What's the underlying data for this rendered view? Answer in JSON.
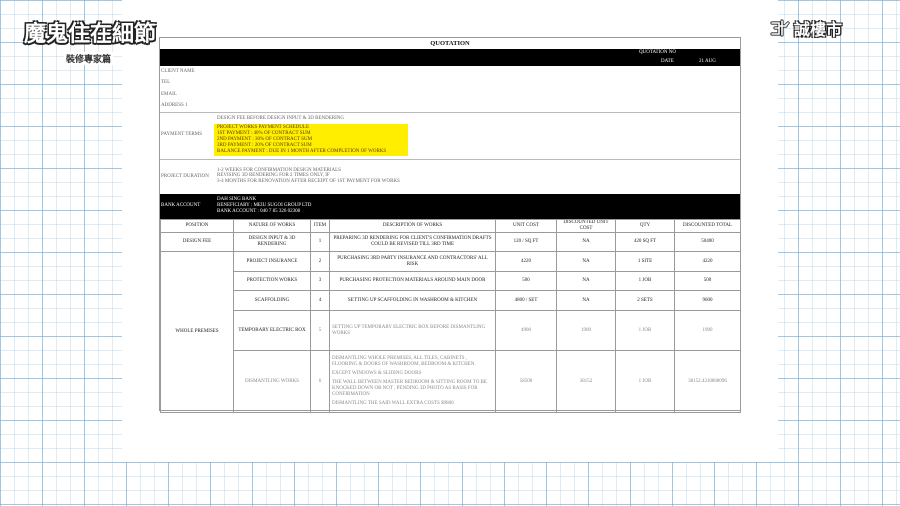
{
  "logos": {
    "left_title": "魔鬼住在細節",
    "left_subtitle": "裝修專家篇",
    "right_title": "誠樓市"
  },
  "doc": {
    "title": "QUOTATION",
    "quotation_no_label": "QUOTATION NO",
    "date_label": "DATE",
    "date_value": "21 AUG",
    "client_fields": [
      "CLIENT NAME",
      "TEL",
      "EMAIL",
      "ADDRESS 1"
    ],
    "design_fee_note": "DESIGN FEE BEFORE DESIGN INPUT & 3D RENDERING",
    "payment_terms_label": "PAYMENT TERMS",
    "payment_schedule": [
      "PROJECT WORKS PAYMENT SCHEDULE",
      "1ST PAYMENT : 40% OF CONTRACT SUM",
      "2ND PAYMENT : 30% OF CONTRACT SUM",
      "3RD PAYMENT : 20% OF CONTRACT SUM",
      "BALANCE PAYMENT : DUE IN 1 MONTH AFTER COMPLETION OF WORKS"
    ],
    "project_duration_label": "PROJECT DURATION",
    "duration_lines": [
      "1-2 WEEKS FOR CONFIRMATION DESIGN MATERIALS",
      "REVISING 3D RENDERING FOR 2 TIMES ONLY, IF",
      "3-4 MONTHS FOR RENOVATION AFTER RECEIPT OF 1ST PAYMENT FOR WORKS"
    ],
    "bank_account_label": "BANK ACCOUNT",
    "bank_lines": [
      "DAH SING BANK",
      "BENEFICIARY : MEIU SUGOI GROUP LTD",
      "BANK ACCOUNT : 040 7 85 326 02308"
    ],
    "table": {
      "headers": [
        "POSITION",
        "NATURE OF WORKS",
        "ITEM",
        "DESCRIPTION OF WORKS",
        "UNIT COST",
        "DISCOUNTED UNIT COST",
        "QTY",
        "DISCOUNTED TOTAL"
      ],
      "rows": [
        {
          "position": "DESIGN FEE",
          "nature": "DESIGN INPUT & 3D RENDERING",
          "item": "1",
          "description": [
            "PREPARING 3D RENDERING FOR CLIENT'S CONFIRMATION DRAFTS COULD BE REVISED TILL 3RD TIME"
          ],
          "unit_cost": "120 / SQ FT",
          "discounted_unit_cost": "NA",
          "qty": "420 SQ FT",
          "discounted_total": "50400"
        },
        {
          "position": "WHOLE PREMISES",
          "nature": "PROJECT INSURANCE",
          "item": "2",
          "description": [
            "PURCHASING 3RD PARTY INSURANCE AND CONTRACTORS' ALL RISK"
          ],
          "unit_cost": "4220",
          "discounted_unit_cost": "NA",
          "qty": "1 SITE",
          "discounted_total": "4220"
        },
        {
          "nature": "PROTECTION WORKS",
          "item": "3",
          "description": [
            "PURCHASING PROTECTION MATERIALS AROUND MAIN DOOR"
          ],
          "unit_cost": "500",
          "discounted_unit_cost": "NA",
          "qty": "1 JOB",
          "discounted_total": "500"
        },
        {
          "nature": "SCAFFOLDING",
          "item": "4",
          "description": [
            "SETTING UP SCAFFOLDING IN WASHROOM & KITCHEN"
          ],
          "unit_cost": "4800 / SET",
          "discounted_unit_cost": "NA",
          "qty": "2 SETS",
          "discounted_total": "9600"
        },
        {
          "nature": "TEMPORARY ELECTRIC BOX",
          "item": "5",
          "description": [
            "SETTING UP TEMPORARY ELECTRIC BOX BEFORE DISMANTLING WORKS"
          ],
          "unit_cost": "4900",
          "discounted_unit_cost": "1900",
          "qty": "1 JOB",
          "discounted_total": "1900"
        },
        {
          "nature": "DISMANTLING WORKS",
          "item": "6",
          "description": [
            "DISMANTLING WHOLE PREMISES, ALL TILES, CABINETS , FLOORING & DOORS OF WASHROOM, BEDROOM & KITCHEN.",
            "EXCEPT WINDOWS & SLIDING DOORS",
            "THE WALL BETWEEN MASTER BEDROOM & SITTING ROOM TO BE KNOCKED DOWN OR NOT , PENDING 3D PHOTO AS BASIS FOR CONFIRMATION",
            "DISMANTLING THE SAID WALL EXTRA COSTS $9800"
          ],
          "unit_cost": "58500",
          "discounted_unit_cost": "38152",
          "qty": "1 JOB",
          "discounted_total": "38152.4310868096"
        }
      ]
    }
  },
  "colors": {
    "highlight": "#ffee00",
    "grid": "#6eaad7",
    "band": "#000000"
  },
  "icons": {
    "right_logo_mark": "brand-mark-icon"
  }
}
